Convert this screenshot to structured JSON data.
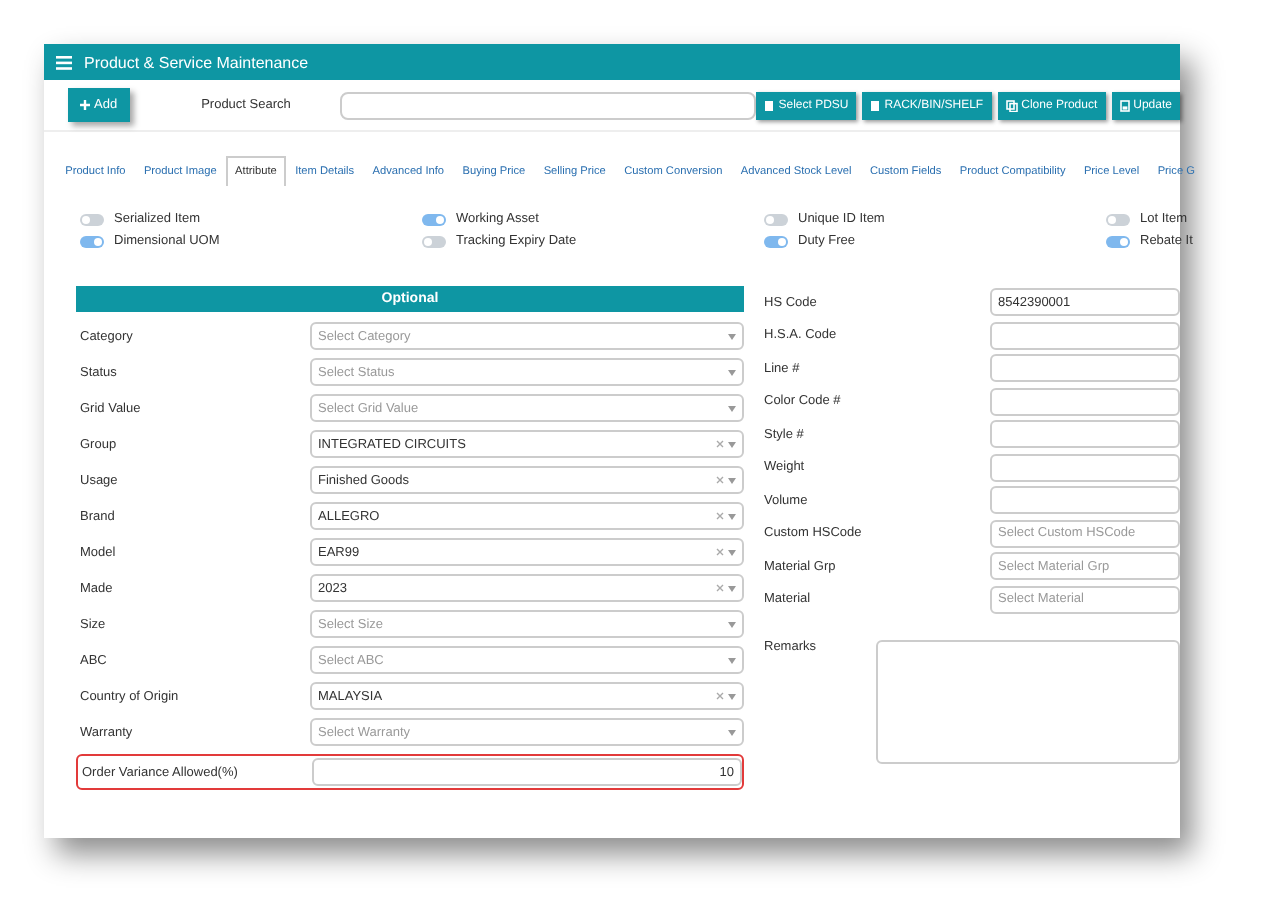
{
  "window": {
    "title": "Product & Service Maintenance"
  },
  "toolbar": {
    "add_button": "Add",
    "search_label": "Product Search",
    "buttons": [
      {
        "label": "Select PDSU"
      },
      {
        "label": "RACK/BIN/SHELF"
      },
      {
        "label": "Clone Product"
      },
      {
        "label": "Update"
      }
    ]
  },
  "tabs": [
    {
      "label": "Product Info",
      "selected": false
    },
    {
      "label": "Product Image",
      "selected": false
    },
    {
      "label": "Attribute",
      "selected": true
    },
    {
      "label": "Item Details",
      "selected": false
    },
    {
      "label": "Advanced Info",
      "selected": false
    },
    {
      "label": "Buying Price",
      "selected": false
    },
    {
      "label": "Selling Price",
      "selected": false
    },
    {
      "label": "Custom Conversion",
      "selected": false
    },
    {
      "label": "Advanced Stock Level",
      "selected": false
    },
    {
      "label": "Custom Fields",
      "selected": false
    },
    {
      "label": "Product Compatibility",
      "selected": false
    },
    {
      "label": "Price Level",
      "selected": false
    },
    {
      "label": "Price G",
      "selected": false
    }
  ],
  "toggles": [
    {
      "label": "Serialized Item",
      "on": false
    },
    {
      "label": "Working Asset",
      "on": true
    },
    {
      "label": "Unique ID Item",
      "on": false
    },
    {
      "label": "Lot Item",
      "on": false
    },
    {
      "label": "Dimensional UOM",
      "on": true
    },
    {
      "label": "Tracking Expiry Date",
      "on": false
    },
    {
      "label": "Duty Free",
      "on": true
    },
    {
      "label": "Rebate It",
      "on": true
    }
  ],
  "optional": {
    "title": "Optional",
    "fields": [
      {
        "label": "Category",
        "placeholder": "Select Category"
      },
      {
        "label": "Status",
        "placeholder": "Select Status"
      },
      {
        "label": "Grid Value",
        "placeholder": "Select Grid Value"
      },
      {
        "label": "Group",
        "value": "INTEGRATED CIRCUITS"
      },
      {
        "label": "Usage",
        "value": "Finished Goods"
      },
      {
        "label": "Brand",
        "value": "ALLEGRO"
      },
      {
        "label": "Model",
        "value": "EAR99"
      },
      {
        "label": "Made",
        "value": "2023"
      },
      {
        "label": "Size",
        "placeholder": "Select Size"
      },
      {
        "label": "ABC",
        "placeholder": "Select ABC"
      },
      {
        "label": "Country of Origin",
        "value": "MALAYSIA"
      },
      {
        "label": "Warranty",
        "placeholder": "Select Warranty"
      }
    ],
    "variance": {
      "label": "Order Variance Allowed(%)",
      "value": "10",
      "highlighted": true
    }
  },
  "right_fields": [
    {
      "label": "HS Code",
      "kind": "text",
      "value": "8542390001"
    },
    {
      "label": "H.S.A. Code",
      "kind": "text"
    },
    {
      "label": "Line #",
      "kind": "text"
    },
    {
      "label": "Color Code #",
      "kind": "text"
    },
    {
      "label": "Style #",
      "kind": "text"
    },
    {
      "label": "Weight",
      "kind": "text"
    },
    {
      "label": "Volume",
      "kind": "text"
    },
    {
      "label": "Custom HSCode",
      "kind": "select",
      "placeholder": "Select Custom HSCode"
    },
    {
      "label": "Material Grp",
      "kind": "select",
      "placeholder": "Select Material Grp"
    },
    {
      "label": "Material",
      "kind": "select",
      "placeholder": "Select Material"
    }
  ],
  "remarks": {
    "label": "Remarks"
  }
}
